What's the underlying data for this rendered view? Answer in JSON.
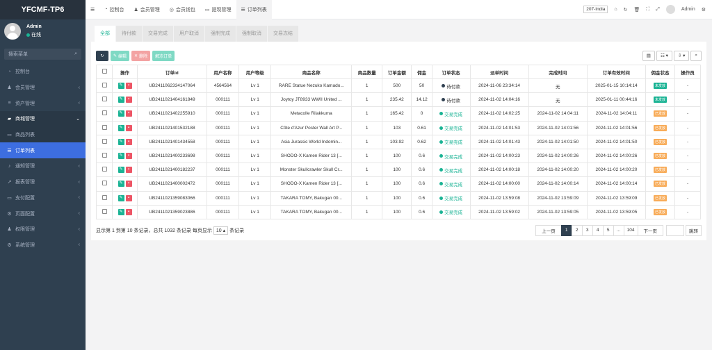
{
  "sidebar": {
    "brand": "YFCMF-TP6",
    "user": {
      "name": "Admin",
      "status": "在线"
    },
    "search_placeholder": "搜索菜单",
    "items": [
      {
        "label": "控制台",
        "icon": "◔"
      },
      {
        "label": "会员管理",
        "icon": "♟"
      },
      {
        "label": "资产管理",
        "icon": "≡"
      },
      {
        "label": "商城管理",
        "icon": "▰"
      },
      {
        "label": "商品列表",
        "icon": "▭"
      },
      {
        "label": "订单列表",
        "icon": "☰"
      },
      {
        "label": "通知管理",
        "icon": "♪"
      },
      {
        "label": "报表管理",
        "icon": "↗"
      },
      {
        "label": "支付配置",
        "icon": "▭"
      },
      {
        "label": "页面配置",
        "icon": "⚙"
      },
      {
        "label": "权限管理",
        "icon": "♟"
      },
      {
        "label": "系统管理",
        "icon": "⚙"
      }
    ]
  },
  "topbar": {
    "tabs": [
      {
        "label": "控制台",
        "icon": "◔"
      },
      {
        "label": "会员管理",
        "icon": "♟"
      },
      {
        "label": "会员钱包",
        "icon": "◎"
      },
      {
        "label": "提现管理",
        "icon": "▭"
      },
      {
        "label": "订单列表",
        "icon": "☰"
      }
    ],
    "region": "207-India",
    "admin": "Admin"
  },
  "filter_tabs": [
    "全部",
    "待付款",
    "交易完成",
    "用户取消",
    "强制完成",
    "强制取消",
    "交易冻结"
  ],
  "toolbar": {
    "edit": "编辑",
    "delete": "删除",
    "unfreeze": "解冻订单"
  },
  "table": {
    "headers": [
      "",
      "操作",
      "订单id",
      "用户名称",
      "用户等级",
      "商品名称",
      "商品数量",
      "订单金额",
      "佣金",
      "订单状态",
      "派单时间",
      "完成时间",
      "订单有效时间",
      "佣金状态",
      "操作员"
    ],
    "rows": [
      [
        "UB2411062334147064",
        "4564564",
        "Lv 1",
        "RARE Statue Nezuko Kamado...",
        "1",
        "500",
        "50",
        "待付款",
        "2024-11-06 23:34:14",
        "无",
        "2025-01-15 10:14:14",
        "未发放",
        "-"
      ],
      [
        "UB2411021404161849",
        "000111",
        "Lv 1",
        "Joytoy JT8933 WWII United ...",
        "1",
        "235.42",
        "14.12",
        "待付款",
        "2024-11-02 14:04:16",
        "无",
        "2025-01-11 00:44:16",
        "未发放",
        "-"
      ],
      [
        "UB2411021402255910",
        "000111",
        "Lv 1",
        "Metacolle Rilakkuma",
        "1",
        "165.42",
        "0",
        "交易完成",
        "2024-11-02 14:02:25",
        "2024-11-02 14:04:11",
        "2024-11-02 14:04:11",
        "已发放",
        "-"
      ],
      [
        "UB2411021401532188",
        "000111",
        "Lv 1",
        "Côte d'Azur Poster Wall Art P...",
        "1",
        "103",
        "0.61",
        "交易完成",
        "2024-11-02 14:01:53",
        "2024-11-02 14:01:56",
        "2024-11-02 14:01:56",
        "已发放",
        "-"
      ],
      [
        "UB2411021401434558",
        "000111",
        "Lv 1",
        "Asia Jurassic World Indomin...",
        "1",
        "103.92",
        "0.62",
        "交易完成",
        "2024-11-02 14:01:43",
        "2024-11-02 14:01:50",
        "2024-11-02 14:01:50",
        "已发放",
        "-"
      ],
      [
        "UB2411021400233698",
        "000111",
        "Lv 1",
        "SHODO-X Kamen Rider 13 [...",
        "1",
        "100",
        "0.6",
        "交易完成",
        "2024-11-02 14:00:23",
        "2024-11-02 14:00:26",
        "2024-11-02 14:00:26",
        "已发放",
        "-"
      ],
      [
        "UB2411021400182237",
        "000111",
        "Lv 1",
        "Monster Skullcrawler Skull Cr...",
        "1",
        "100",
        "0.6",
        "交易完成",
        "2024-11-02 14:00:18",
        "2024-11-02 14:00:20",
        "2024-11-02 14:00:20",
        "已发放",
        "-"
      ],
      [
        "UB2411021400002472",
        "000111",
        "Lv 1",
        "SHODO-X Kamen Rider 13 [...",
        "1",
        "100",
        "0.6",
        "交易完成",
        "2024-11-02 14:00:00",
        "2024-11-02 14:00:14",
        "2024-11-02 14:00:14",
        "已发放",
        "-"
      ],
      [
        "UB2411021359083066",
        "000111",
        "Lv 1",
        "TAKARA TOMY, Bakugan 00...",
        "1",
        "100",
        "0.6",
        "交易完成",
        "2024-11-02 13:59:08",
        "2024-11-02 13:59:09",
        "2024-11-02 13:59:09",
        "已发放",
        "-"
      ],
      [
        "UB2411021359023886",
        "000111",
        "Lv 1",
        "TAKARA TOMY, Bakugan 00...",
        "1",
        "100",
        "0.6",
        "交易完成",
        "2024-11-02 13:59:02",
        "2024-11-02 13:59:05",
        "2024-11-02 13:59:05",
        "已发放",
        "-"
      ]
    ]
  },
  "footer": {
    "summary_prefix": "显示第 1 到第 10 条记录，总共 1032 条记录 每页显示",
    "page_size": "10 ▴",
    "summary_suffix": "条记录",
    "pager": [
      "上一页",
      "1",
      "2",
      "3",
      "4",
      "5",
      "...",
      "104",
      "下一页"
    ],
    "jump": "跳转"
  },
  "colors": {
    "sidebar": "#2f4050",
    "active": "#3d6ee0",
    "green": "#1ab394",
    "red": "#ed5565",
    "orange": "#f8ac59"
  }
}
